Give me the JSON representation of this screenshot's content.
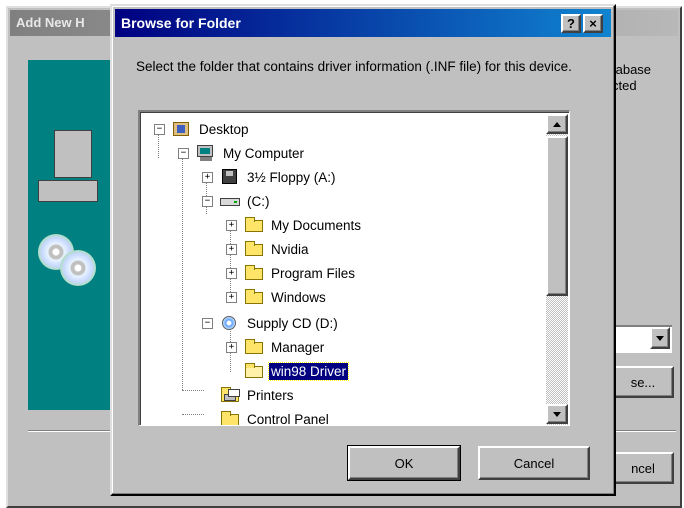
{
  "background_window": {
    "title": "Add New H",
    "right_text_lines": [
      "tabase",
      "cted"
    ],
    "browse_button_label": "se...",
    "cancel_button_label": "ncel"
  },
  "dialog": {
    "title": "Browse for Folder",
    "help_label": "?",
    "close_label": "×",
    "instruction": "Select the folder that contains driver information (.INF file) for this device.",
    "ok_label": "OK",
    "cancel_label": "Cancel"
  },
  "tree": {
    "items": [
      {
        "label": "Desktop",
        "icon": "desktop-icon",
        "expander": "−"
      },
      {
        "label": "My Computer",
        "icon": "my-computer-icon",
        "expander": "−"
      },
      {
        "label": "3½ Floppy (A:)",
        "icon": "floppy-drive-icon",
        "expander": "+"
      },
      {
        "label": "(C:)",
        "icon": "hard-drive-icon",
        "expander": "−"
      },
      {
        "label": "My Documents",
        "icon": "folder-icon",
        "expander": "+"
      },
      {
        "label": "Nvidia",
        "icon": "folder-icon",
        "expander": "+"
      },
      {
        "label": "Program Files",
        "icon": "folder-icon",
        "expander": "+"
      },
      {
        "label": "Windows",
        "icon": "folder-icon",
        "expander": "+"
      },
      {
        "label": "Supply CD (D:)",
        "icon": "cd-drive-icon",
        "expander": "−"
      },
      {
        "label": "Manager",
        "icon": "folder-icon",
        "expander": "+"
      },
      {
        "label": "win98 Driver",
        "icon": "open-folder-icon",
        "expander": "",
        "selected": true
      },
      {
        "label": "Printers",
        "icon": "printer-folder-icon",
        "expander": ""
      },
      {
        "label": "Control Panel",
        "icon": "control-panel-icon",
        "expander": ""
      }
    ]
  },
  "colors": {
    "title_bar": "#000080",
    "selection": "#000080",
    "face": "#c0c0c0",
    "wizard_panel": "#008080"
  }
}
